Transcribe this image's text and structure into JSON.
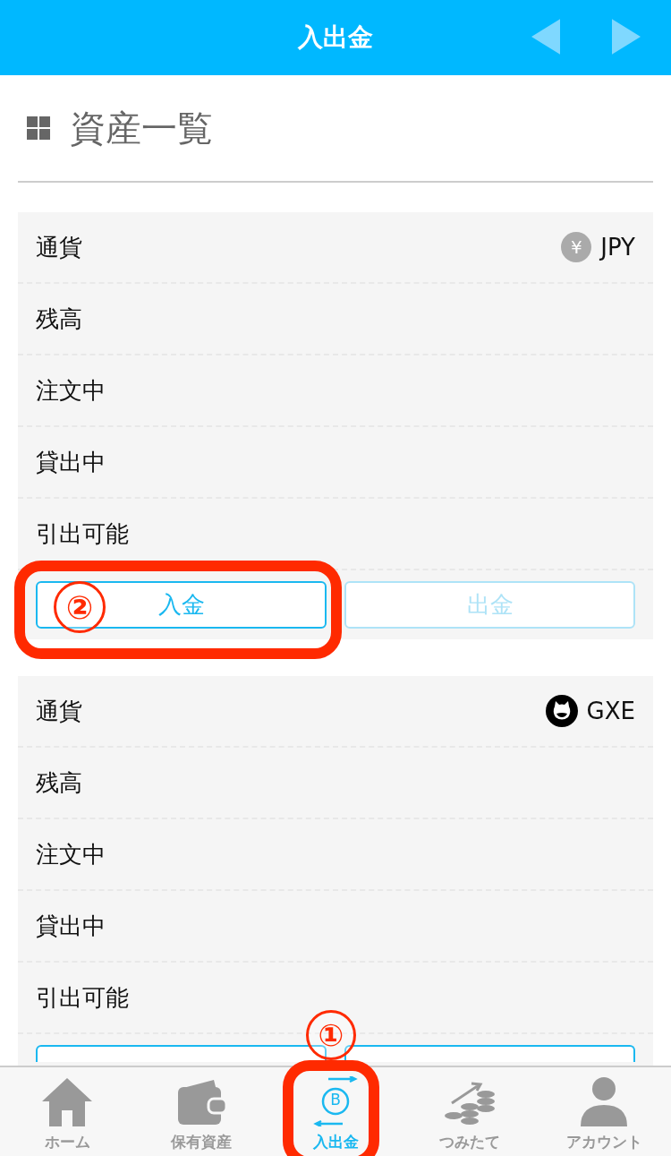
{
  "header": {
    "title": "入出金"
  },
  "section": {
    "title": "資産一覧"
  },
  "cards": [
    {
      "currency": {
        "kind": "yen",
        "code": "JPY",
        "glyph": "¥"
      },
      "rows": [
        "通貨",
        "残高",
        "注文中",
        "貸出中",
        "引出可能"
      ],
      "buttons": [
        {
          "label": "入金",
          "disabled": false
        },
        {
          "label": "出金",
          "disabled": true
        }
      ],
      "annotation": {
        "label": "②"
      }
    },
    {
      "currency": {
        "kind": "gxe",
        "code": "GXE"
      },
      "rows": [
        "通貨",
        "残高",
        "注文中",
        "貸出中",
        "引出可能"
      ],
      "buttons": [
        {
          "disabled": false
        },
        {
          "disabled": false
        }
      ]
    }
  ],
  "tab_bar": {
    "items": [
      {
        "kind": "home",
        "label": "ホーム",
        "selected": false
      },
      {
        "kind": "wallet",
        "label": "保有資産",
        "selected": false
      },
      {
        "kind": "exchange",
        "label": "入出金",
        "selected": true,
        "glyph": "B",
        "annotation": {
          "label": "①"
        }
      },
      {
        "kind": "coins",
        "label": "つみたて",
        "selected": false
      },
      {
        "kind": "account",
        "label": "アカウント",
        "selected": false
      }
    ]
  }
}
